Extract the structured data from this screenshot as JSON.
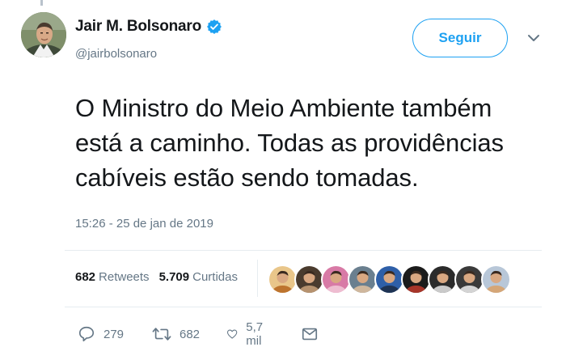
{
  "author": {
    "display_name": "Jair M. Bolsonaro",
    "handle": "@jairbolsonaro",
    "verified": true,
    "avatar_icon": "avatar-photo"
  },
  "follow_button": {
    "label": "Seguir"
  },
  "menu": {
    "icon": "chevron-down-icon"
  },
  "tweet": {
    "lines": [
      "O Ministro do Meio Ambiente também",
      "está a caminho. Todas as providências",
      "cabíveis estão sendo tomadas."
    ],
    "timestamp": "15:26 - 25 de jan de 2019"
  },
  "stats": {
    "retweets_count": "682",
    "retweets_label": "Retweets",
    "likes_count": "5.709",
    "likes_label": "Curtidas"
  },
  "likers": [
    {
      "name": "liker-avatar-1",
      "bg": "#e9c68a",
      "fg": "#b5651d"
    },
    {
      "name": "liker-avatar-2",
      "bg": "#4a3b2e",
      "fg": "#c9a27a"
    },
    {
      "name": "liker-avatar-3",
      "bg": "#d87aa6",
      "fg": "#f2c9d8"
    },
    {
      "name": "liker-avatar-4",
      "bg": "#6a7f8f",
      "fg": "#e0c1a0"
    },
    {
      "name": "liker-avatar-5",
      "bg": "#2e5fa8",
      "fg": "#1b2c44"
    },
    {
      "name": "liker-avatar-6",
      "bg": "#1b1b1b",
      "fg": "#c0392b"
    },
    {
      "name": "liker-avatar-7",
      "bg": "#2b2b2b",
      "fg": "#e6e6e6"
    },
    {
      "name": "liker-avatar-8",
      "bg": "#3a3a3a",
      "fg": "#f0f0f0"
    },
    {
      "name": "liker-avatar-9",
      "bg": "#b8c7d8",
      "fg": "#d9a066"
    }
  ],
  "actions": {
    "reply": {
      "icon": "reply-icon",
      "count": "279"
    },
    "retweet": {
      "icon": "retweet-icon",
      "count": "682"
    },
    "like": {
      "icon": "heart-icon",
      "count": "5,7 mil"
    },
    "message": {
      "icon": "direct-message-icon"
    }
  },
  "colors": {
    "accent": "#1da1f2",
    "text_primary": "#14171a",
    "text_secondary": "#657786",
    "divider": "#e6ecf0"
  }
}
